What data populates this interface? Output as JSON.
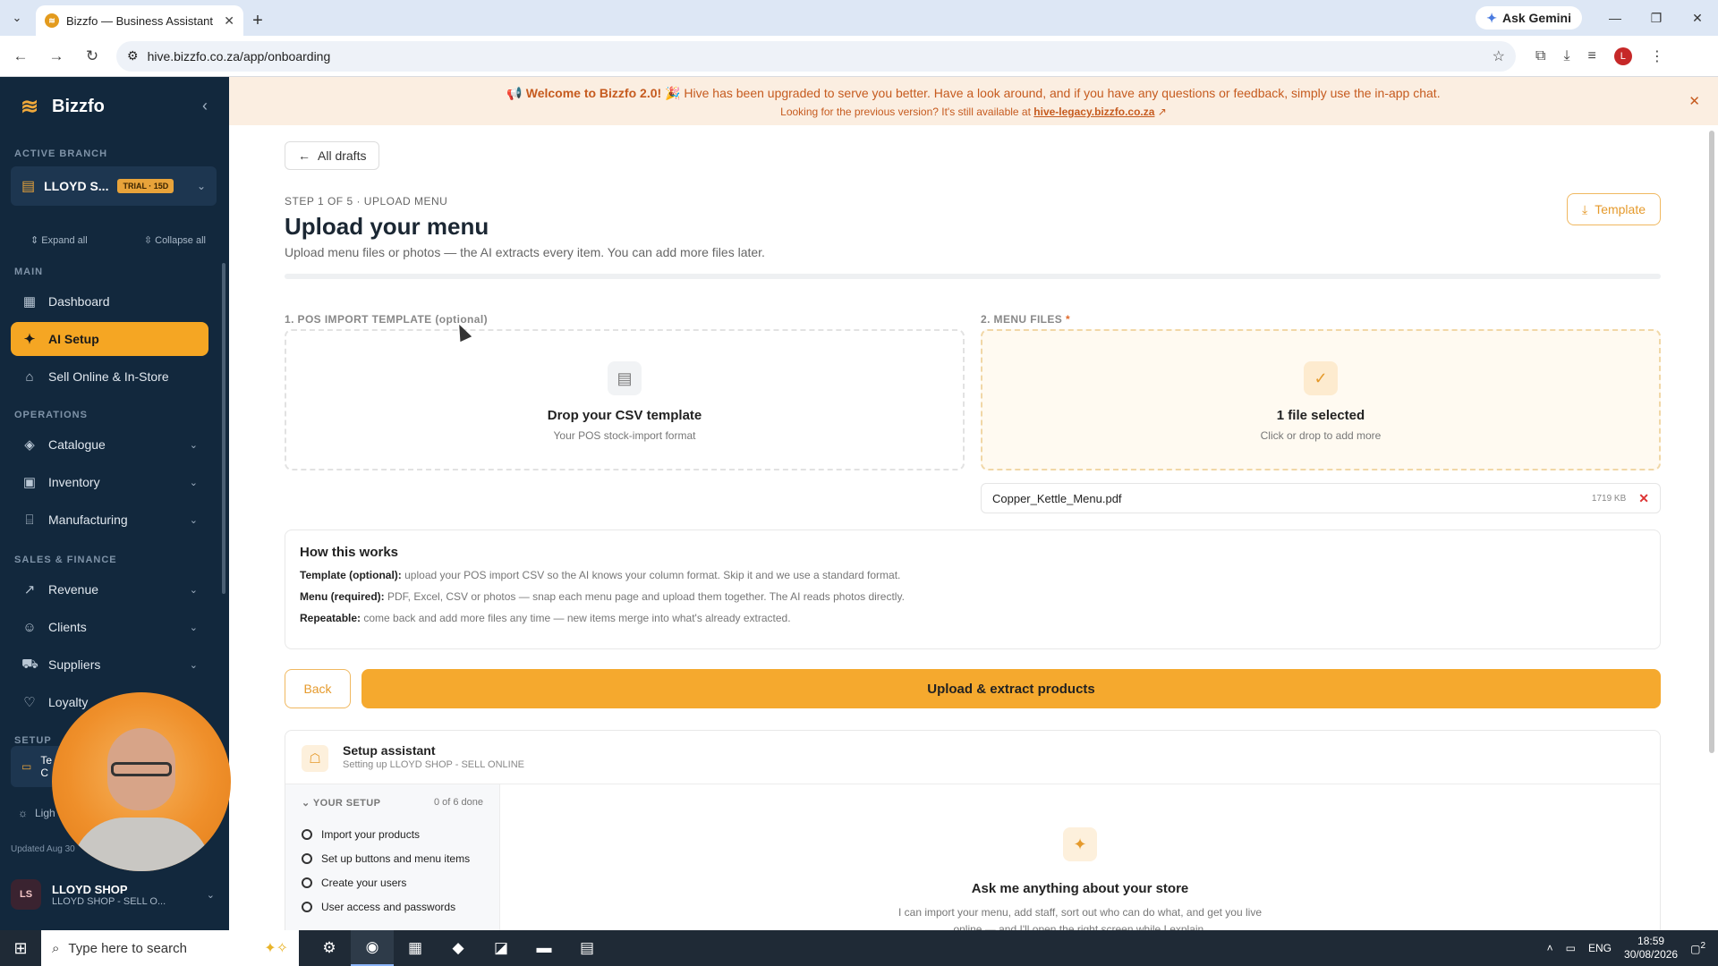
{
  "browser": {
    "tab_title": "Bizzfo — Business Assistant",
    "ask_gemini": "Ask Gemini",
    "url": "hive.bizzfo.co.za/app/onboarding"
  },
  "sidebar": {
    "brand": "Bizzfo",
    "active_branch_label": "ACTIVE BRANCH",
    "branch_name": "LLOYD S...",
    "trial_badge": "TRIAL · 15D",
    "expand_all": "Expand all",
    "collapse_all": "Collapse all",
    "section_main": "MAIN",
    "section_operations": "OPERATIONS",
    "section_sales": "SALES & FINANCE",
    "section_setup": "SETUP",
    "items": [
      {
        "label": "Dashboard"
      },
      {
        "label": "AI Setup"
      },
      {
        "label": "Sell Online & In-Store"
      },
      {
        "label": "Catalogue"
      },
      {
        "label": "Inventory"
      },
      {
        "label": "Manufacturing"
      },
      {
        "label": "Revenue"
      },
      {
        "label": "Clients"
      },
      {
        "label": "Suppliers"
      },
      {
        "label": "Loyalty"
      }
    ],
    "setup_item_a": "Te",
    "setup_item_b": "C",
    "theme_label": "Ligh",
    "updated": "Updated Aug 30",
    "user_initials": "LS",
    "user_name": "LLOYD SHOP",
    "user_sub": "LLOYD SHOP - SELL O..."
  },
  "banner": {
    "welcome": "Welcome to Bizzfo 2.0!",
    "message": "Hive has been upgraded to serve you better. Have a look around, and if you have any questions or feedback, simply use the in-app chat.",
    "legacy_prefix": "Looking for the previous version? It's still available at",
    "legacy_link": "hive-legacy.bizzfo.co.za"
  },
  "page": {
    "all_drafts": "All drafts",
    "step": "STEP 1 OF 5 · UPLOAD MENU",
    "title": "Upload your menu",
    "subtitle": "Upload menu files or photos — the AI extracts every item. You can add more files later.",
    "template_button": "Template",
    "pos_label": "1. POS IMPORT TEMPLATE",
    "pos_optional": "(optional)",
    "pos_drop_title": "Drop your CSV template",
    "pos_drop_sub": "Your POS stock-import format",
    "menu_label": "2. MENU FILES",
    "menu_required": "*",
    "menu_title": "1 file selected",
    "menu_sub": "Click or drop to add more",
    "file_name": "Copper_Kettle_Menu.pdf",
    "file_size": "1719 KB",
    "how_title": "How this works",
    "how_template_label": "Template (optional):",
    "how_template_text": "upload your POS import CSV so the AI knows your column format. Skip it and we use a standard format.",
    "how_menu_label": "Menu (required):",
    "how_menu_text": "PDF, Excel, CSV or photos — snap each menu page and upload them together. The AI reads photos directly.",
    "how_repeat_label": "Repeatable:",
    "how_repeat_text": "come back and add more files any time — new items merge into what's already extracted.",
    "back": "Back",
    "upload": "Upload & extract products"
  },
  "assistant": {
    "title": "Setup assistant",
    "subtitle": "Setting up LLOYD SHOP - SELL ONLINE",
    "your_setup": "YOUR SETUP",
    "done_count": "0 of 6 done",
    "tasks": [
      "Import your products",
      "Set up buttons and menu items",
      "Create your users",
      "User access and passwords"
    ],
    "question": "Ask me anything about your store",
    "desc_line1": "I can import your menu, add staff, sort out who can do what, and get you live",
    "desc_line2": "online — and I'll open the right screen while I explain."
  },
  "taskbar": {
    "search_placeholder": "Type here to search",
    "lang": "ENG",
    "time": "18:59",
    "date": "30/08/2026",
    "notif_count": "2"
  },
  "colors": {
    "accent": "#f5a92e",
    "sidebar_bg": "#12283d",
    "banner_bg": "#fbeee1",
    "banner_text": "#c65b1f"
  }
}
